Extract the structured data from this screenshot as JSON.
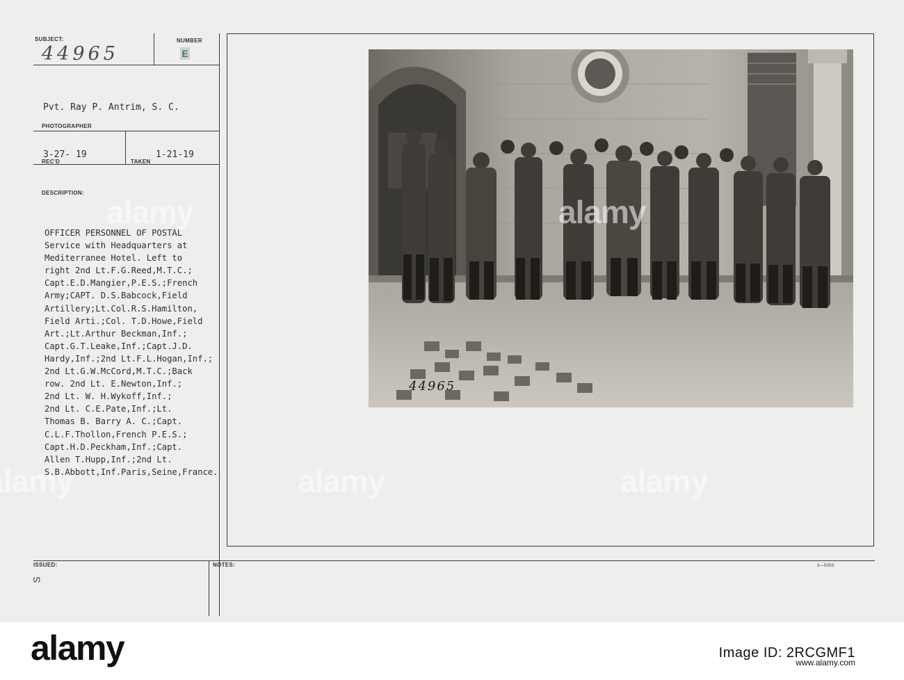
{
  "card": {
    "subject_label": "SUBJECT:",
    "subject_value": "44965",
    "number_label": "NUMBER",
    "number_value": "E",
    "photographer_name": "Pvt. Ray P. Antrim, S. C.",
    "photographer_label": "PHOTOGRAPHER",
    "received_date": "3-27- 19",
    "received_label": "REC'D",
    "taken_date": "1-21-19",
    "taken_label": "TAKEN",
    "description_label": "DESCRIPTION:",
    "description": "OFFICER PERSONNEL OF POSTAL\nService with Headquarters at\nMediterranee Hotel. Left to\nright 2nd Lt.F.G.Reed,M.T.C.;\nCapt.E.D.Mangier,P.E.S.;French\nArmy;CAPT. D.S.Babcock,Field\nArtillery;Lt.Col.R.S.Hamilton,\nField Arti.;Col. T.D.Howe,Field\nArt.;Lt.Arthur Beckman,Inf.;\nCapt.G.T.Leake,Inf.;Capt.J.D.\nHardy,Inf.;2nd Lt.F.L.Hogan,Inf.;\n2nd Lt.G.W.McCord,M.T.C.;Back\nrow. 2nd Lt. E.Newton,Inf.;\n2nd Lt. W. H.Wykoff,Inf.;\n2nd Lt. C.E.Pate,Inf.;Lt.\nThomas B. Barry A. C.;Capt.\nC.L.F.Thollon,French P.E.S.;\nCapt.H.D.Peckham,Inf.;Capt.\nAllen T.Hupp,Inf.;2nd Lt.\nS.B.Abbott,Inf.Paris,Seine,France.",
    "issued_label": "ISSUED:",
    "issued_mark": "S",
    "notes_label": "NOTES:",
    "form_number": "3—5003",
    "photo_number": "44965"
  },
  "watermark": {
    "text": "alamy"
  },
  "footer": {
    "logo": "alamy",
    "image_id_line": "Image ID: 2RCGMF1",
    "url": "www.alamy.com"
  },
  "colors": {
    "card_bg": "#eeeeec",
    "photo_sepia": "#8a8780",
    "footer_bg": "#ffffff"
  }
}
